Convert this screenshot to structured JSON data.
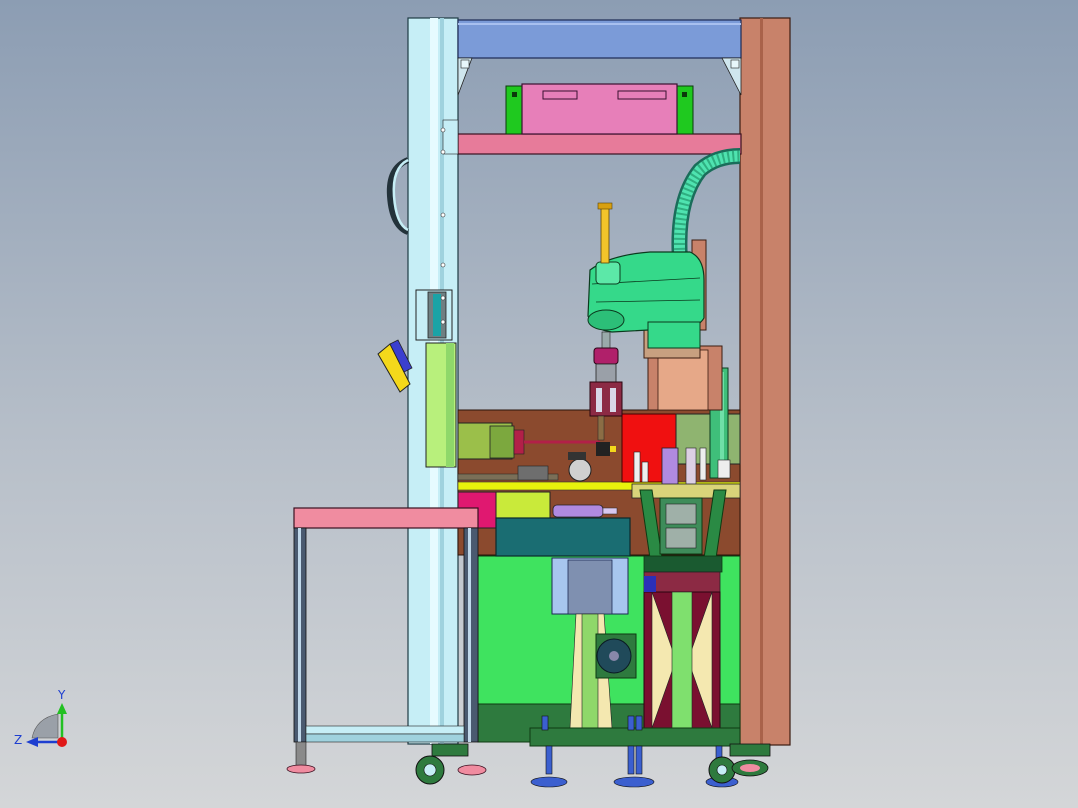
{
  "view": {
    "kind": "cad-assembly-viewport",
    "background": {
      "top": "#8c9db3",
      "bottom": "#d4d6d8"
    }
  },
  "triad": {
    "y_label": "Y",
    "z_label": "Z",
    "y_color": "#22c022",
    "z_color": "#1d3ed0",
    "origin_color": "#e01818"
  },
  "colors": {
    "frame_left": "#b8e6ef",
    "frame_right": "#c8826a",
    "top_beam": "#7b9bd8",
    "shelf": "#e77b9a",
    "cabinet": "#e77fb9",
    "robot": "#35d98a",
    "lower_panel": "#3fe35f",
    "bench_top": "#f08ca0",
    "red_block": "#f01010",
    "teal_box": "#1a6d72",
    "maroon": "#7a1030",
    "brown_plate": "#8b4a2e"
  }
}
